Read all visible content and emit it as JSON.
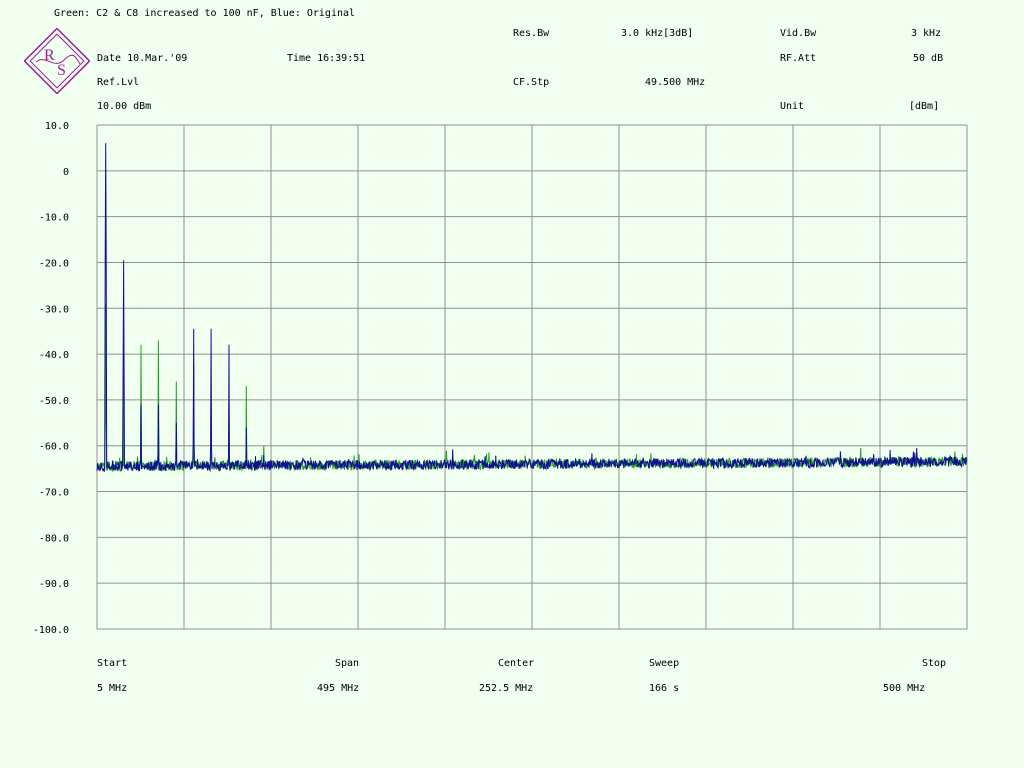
{
  "header": {
    "title": "Green: C2 & C8 increased to 100 nF, Blue: Original",
    "date_label": "Date 10.Mar.'09",
    "time_label": "Time 16:39:51",
    "reflvl_label": "Ref.Lvl",
    "reflvl_value": "10.00 dBm",
    "resbw_label": "Res.Bw",
    "resbw_value": "3.0 kHz[3dB]",
    "cfstp_label": "CF.Stp",
    "cfstp_value": "49.500 MHz",
    "vidbw_label": "Vid.Bw",
    "vidbw_value": "3 kHz",
    "rfatt_label": "RF.Att",
    "rfatt_value": "50 dB",
    "unit_label": "Unit",
    "unit_value": "[dBm]"
  },
  "logo": {
    "icon": "rohde-schwarz-logo",
    "color": "#a0209a"
  },
  "footer": {
    "start_label": "Start",
    "start_value": "5 MHz",
    "span_label": "Span",
    "span_value": "495 MHz",
    "center_label": "Center",
    "center_value": "252.5 MHz",
    "sweep_label": "Sweep",
    "sweep_value": "166 s",
    "stop_label": "Stop",
    "stop_value": "500 MHz"
  },
  "chart_data": {
    "type": "line",
    "xlim": [
      5,
      500
    ],
    "ylim": [
      -100,
      10
    ],
    "x_unit": "MHz",
    "y_unit": "dBm",
    "y_ticks": [
      "10.0",
      "0",
      "-10.0",
      "-20.0",
      "-30.0",
      "-40.0",
      "-50.0",
      "-60.0",
      "-70.0",
      "-80.0",
      "-90.0",
      "-100.0"
    ],
    "x_divisions": 10,
    "grid": true,
    "colors": {
      "grid": "#909090",
      "frame": "#909090",
      "green": "#20a020",
      "blue": "#101090"
    },
    "noise_floor": {
      "start_level": -64.5,
      "end_level": -63.5
    },
    "series": [
      {
        "color": "#20a020",
        "peaks": [
          {
            "x": 10,
            "y": -29
          },
          {
            "x": 20,
            "y": -42
          },
          {
            "x": 30,
            "y": -38
          },
          {
            "x": 40,
            "y": -37
          },
          {
            "x": 50,
            "y": -46
          },
          {
            "x": 60,
            "y": -42
          },
          {
            "x": 70,
            "y": -50
          },
          {
            "x": 80,
            "y": -51
          },
          {
            "x": 90,
            "y": -47
          },
          {
            "x": 100,
            "y": -60
          }
        ]
      },
      {
        "color": "#101090",
        "peaks": [
          {
            "x": 10,
            "y": 6
          },
          {
            "x": 20,
            "y": -19.5
          },
          {
            "x": 30,
            "y": -51
          },
          {
            "x": 40,
            "y": -51
          },
          {
            "x": 50,
            "y": -55
          },
          {
            "x": 60,
            "y": -34.5
          },
          {
            "x": 70,
            "y": -34.5
          },
          {
            "x": 80,
            "y": -38
          },
          {
            "x": 90,
            "y": -56
          },
          {
            "x": 100,
            "y": -62
          }
        ]
      }
    ]
  }
}
